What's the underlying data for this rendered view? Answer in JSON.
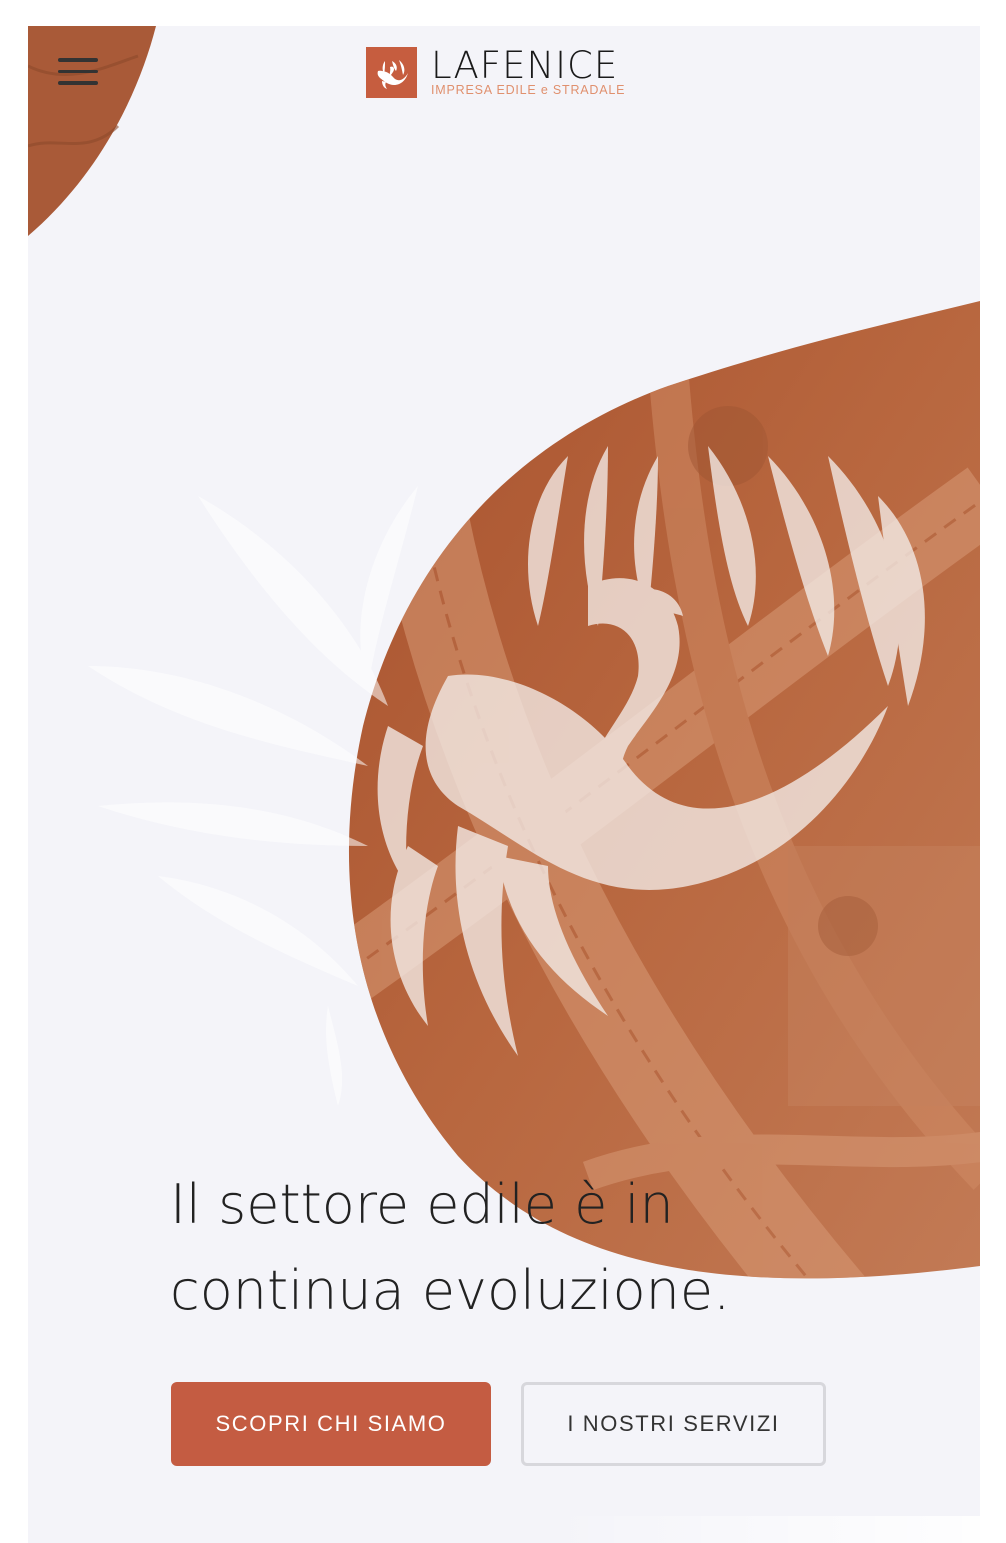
{
  "header": {
    "menu_icon": "hamburger-menu-icon",
    "logo": {
      "name_prefix": "LA",
      "name": "FENICE",
      "subtitle": "IMPRESA EDILE e STRADALE",
      "icon": "phoenix-icon"
    }
  },
  "hero": {
    "headline": "Il settore edile è in continua evoluzione.",
    "background_icon": "phoenix-icon"
  },
  "actions": {
    "primary_label": "SCOPRI CHI SIAMO",
    "secondary_label": "I NOSTRI SERVIZI"
  },
  "colors": {
    "accent": "#c45c42",
    "background": "#f4f4f9",
    "text": "#222222"
  }
}
